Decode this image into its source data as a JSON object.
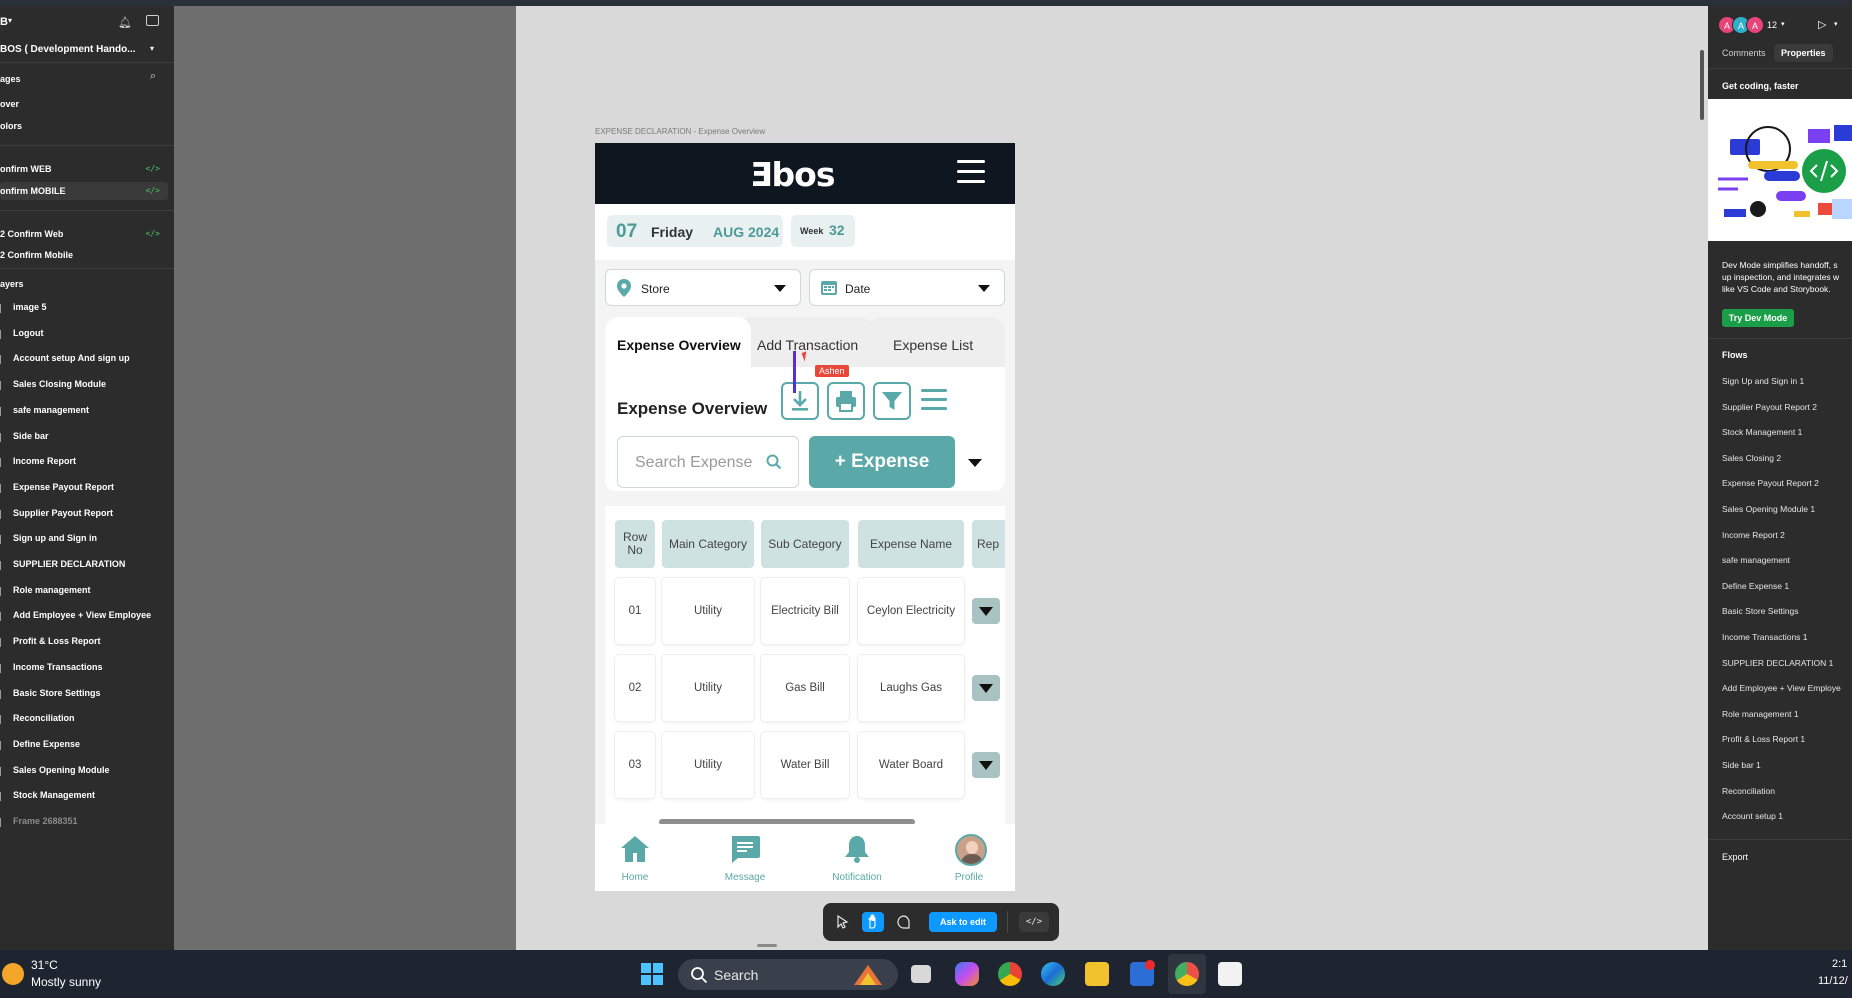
{
  "left_panel": {
    "file_title": "BOS ( Development Hando...",
    "logo_glyph": "B",
    "pages_heading": "ages",
    "pages": [
      {
        "label": "over"
      },
      {
        "label": "olors"
      },
      {
        "label": "onfirm WEB"
      },
      {
        "label": "onfirm  MOBILE"
      },
      {
        "label": "2 Confirm Web"
      },
      {
        "label": "2 Confirm Mobile"
      }
    ],
    "layers_heading": "ayers",
    "layers": [
      "image 5",
      "Logout",
      "Account setup And sign up",
      "Sales Closing Module",
      "safe management",
      "Side bar",
      "Income Report",
      "Expense Payout Report",
      "Supplier Payout Report",
      "Sign up and Sign in",
      "SUPPLIER DECLARATION",
      "Role management",
      "Add Employee + View Employee",
      "Profit & Loss Report",
      "Income Transactions",
      "Basic Store Settings",
      "Reconciliation",
      "Define Expense",
      "Sales Opening Module",
      "Stock Management",
      "Frame 2688351"
    ]
  },
  "canvas": {
    "frame_label": "EXPENSE DECLARATION - Expense Overview"
  },
  "phone": {
    "logo": "Ǝbos",
    "date": {
      "day": "07",
      "weekday": "Friday",
      "month_year": "AUG  2024",
      "week_label": "Week",
      "week_number": "32"
    },
    "store_select": "Store",
    "date_select": "Date",
    "tabs": [
      "Expense Overview",
      "Add Transaction",
      "Expense List"
    ],
    "section_title": "Expense Overview",
    "search_placeholder": "Search Expense",
    "add_button": "+ Expense",
    "table": {
      "headers": [
        "Row No",
        "Main Category",
        "Sub Category",
        "Expense Name",
        "Rep"
      ],
      "rows": [
        [
          "01",
          "Utility",
          "Electricity Bill",
          "Ceylon Electricity"
        ],
        [
          "02",
          "Utility",
          "Gas Bill",
          "Laughs Gas"
        ],
        [
          "03",
          "Utility",
          "Water Bill",
          "Water Board"
        ]
      ]
    },
    "nav": [
      "Home",
      "Message",
      "Notification",
      "Profile"
    ]
  },
  "cursor": {
    "user": "Ashen"
  },
  "toolbar": {
    "ask_label": "Ask to edit",
    "code_label": "</>"
  },
  "right_panel": {
    "avatar_letters": [
      "A",
      "A",
      "A"
    ],
    "avatar_count": "12",
    "tabs": [
      "Comments",
      "Properties"
    ],
    "promo_title": "Get coding, faster",
    "promo_text_1": "Dev Mode simplifies handoff, s",
    "promo_text_2": "up inspection, and integrates w",
    "promo_text_3": "like VS Code and Storybook.",
    "dev_button": "Try Dev Mode",
    "flows_heading": "Flows",
    "flows": [
      "Sign Up and Sign in 1",
      "Supplier Payout Report 2",
      "Stock Management 1",
      "Sales Closing 2",
      "Expense Payout Report 2",
      "Sales Opening Module 1",
      "Income Report 2",
      "safe management",
      "Define Expense 1",
      "Basic Store Settings",
      "Income Transactions 1",
      "SUPPLIER DECLARATION 1",
      "Add Employee + View Employe",
      "Role management 1",
      "Profit & Loss Report 1",
      "Side bar 1",
      "Reconciliation",
      "Account setup 1"
    ],
    "export_label": "Export"
  },
  "taskbar": {
    "temperature": "31°C",
    "weather": "Mostly sunny",
    "search": "Search",
    "time": "2:1",
    "date": "11/12/"
  },
  "colors": {
    "accent": "#5aa8a8",
    "figma_blue": "#0d99ff",
    "dark": "#2c2c2c"
  }
}
